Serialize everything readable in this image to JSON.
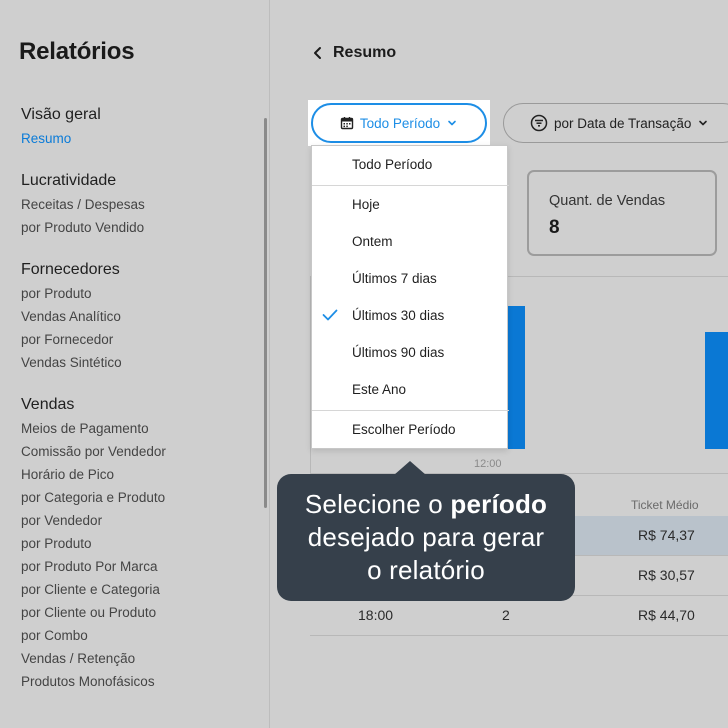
{
  "sidebar": {
    "title": "Relatórios",
    "groups": [
      {
        "title": "Visão geral",
        "items": [
          "Resumo"
        ]
      },
      {
        "title": "Lucratividade",
        "items": [
          "Receitas / Despesas",
          "por Produto Vendido"
        ]
      },
      {
        "title": "Fornecedores",
        "items": [
          "por Produto",
          "Vendas Analítico",
          "por Fornecedor",
          "Vendas Sintético"
        ]
      },
      {
        "title": "Vendas",
        "items": [
          "Meios de Pagamento",
          "Comissão por Vendedor",
          "Horário de Pico",
          "por Categoria e Produto",
          "por Vendedor",
          "por Produto",
          "por Produto Por Marca",
          "por Cliente e Categoria",
          "por Cliente ou Produto",
          "por Combo",
          "Vendas / Retenção",
          "Produtos Monofásicos"
        ]
      }
    ]
  },
  "header": {
    "title": "Resumo"
  },
  "filters": {
    "period_label": "Todo Período",
    "date_type_label": "por Data de Transação"
  },
  "dropdown": {
    "items": [
      "Todo Período",
      "Hoje",
      "Ontem",
      "Últimos 7 dias",
      "Últimos 30 dias",
      "Últimos 90 dias",
      "Este Ano",
      "Escolher Período"
    ],
    "selected": "Últimos 30 dias"
  },
  "card": {
    "label": "Quant. de Vendas",
    "value": "8"
  },
  "chart_data": {
    "type": "bar",
    "x_tick_labels": [
      "12:00"
    ],
    "bars_visible": 2
  },
  "table": {
    "header_ticket": "Ticket Médio",
    "rows": [
      {
        "hour": "",
        "qty": "",
        "ticket": "R$ 74,37"
      },
      {
        "hour": "",
        "qty": "",
        "ticket": "R$ 30,57"
      },
      {
        "hour": "18:00",
        "qty": "2",
        "ticket": "R$ 44,70"
      }
    ]
  },
  "tooltip": {
    "line1_prefix": "Selecione o ",
    "line1_bold": "período",
    "line2": "desejado para gerar",
    "line3": "o relatório"
  },
  "colors": {
    "accent": "#1d8ee6",
    "bar": "#0a78d4",
    "active_link": "#0a7bd8",
    "tooltip_bg": "#36404b"
  }
}
